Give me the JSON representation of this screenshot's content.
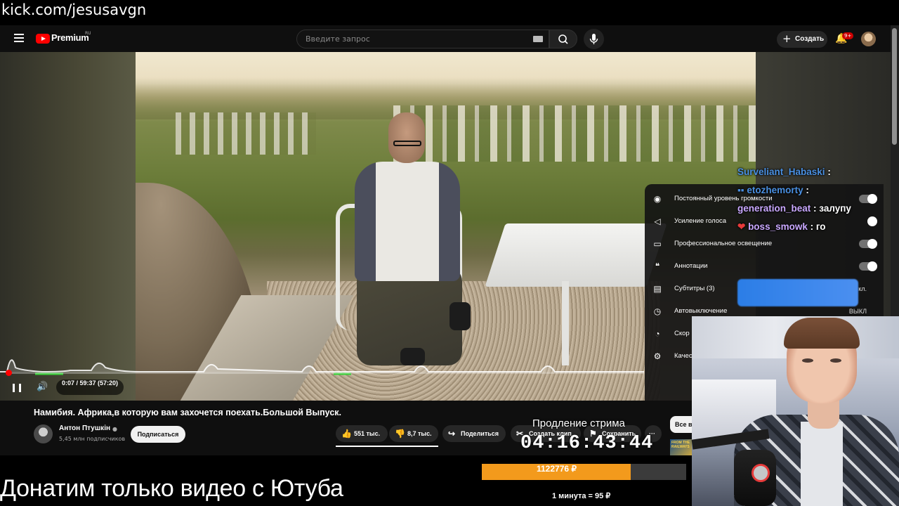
{
  "overlay": {
    "stream_url": "kick.com/jesusavgn",
    "stream_extension_label": "Продление стрима",
    "stream_timer": "04:16:43:44",
    "donate_text": "Донатим только видео с Ютуба",
    "goal_amount": "1122776 ₽",
    "goal_progress_fraction": 0.73,
    "rate": "1 минута = 95 ₽"
  },
  "youtube": {
    "brand": "Premium",
    "region": "RU",
    "search_placeholder": "Введите запрос",
    "create_label": "Создать",
    "notif_badge": "9+"
  },
  "player": {
    "time_display": "0:07 / 59:37 (57:20)",
    "progress_fraction": 0.002
  },
  "settings_menu": {
    "items": [
      {
        "icon": "stable-volume-icon",
        "label": "Постоянный уровень громкости",
        "value": ""
      },
      {
        "icon": "voice-boost-icon",
        "label": "Усиление голоса",
        "value": ""
      },
      {
        "icon": "lighting-icon",
        "label": "Профессиональное освещение",
        "value": ""
      },
      {
        "icon": "annotations-icon",
        "label": "Аннотации",
        "value": ""
      },
      {
        "icon": "subtitles-icon",
        "label": "Субтитры (3)",
        "value": "кл."
      },
      {
        "icon": "sleep-timer-icon",
        "label": "Автовыключение",
        "value": "ВЫКЛ"
      },
      {
        "icon": "speed-icon",
        "label": "Скор",
        "value": ""
      },
      {
        "icon": "quality-icon",
        "label": "Качес",
        "value": ""
      }
    ]
  },
  "chat": [
    {
      "user": "Surveliant_Habaski",
      "sep": " :",
      "message": "",
      "color": "#4a90e2"
    },
    {
      "user": "etozhemorty",
      "sep": " :",
      "message": "",
      "color": "#4a90e2"
    },
    {
      "user": "generation_beat",
      "sep": " : ",
      "message": "залупу",
      "color": "#c9a8ff"
    },
    {
      "user": "boss_smowk",
      "sep": " : ",
      "message": "го",
      "color": "#c9a8ff"
    }
  ],
  "video": {
    "title": "Намибия. Африка,в которую вам захочется поехать.Большой Выпуск.",
    "channel": "Антон Птушкін",
    "subscribers": "5,45 млн подписчиков",
    "subscribe_label": "Подписаться",
    "likes": "551 тыс.",
    "dislikes": "8,7 тыс.",
    "share_label": "Поделиться",
    "clip_label": "Создать клип",
    "save_label": "Сохранить",
    "all_label": "Все в",
    "thumb_text": "FROM THE RAILWAYS"
  },
  "colors": {
    "youtube_red": "#ff0000",
    "goal_orange": "#f39a1c",
    "progress_green": "#3ad13a"
  }
}
